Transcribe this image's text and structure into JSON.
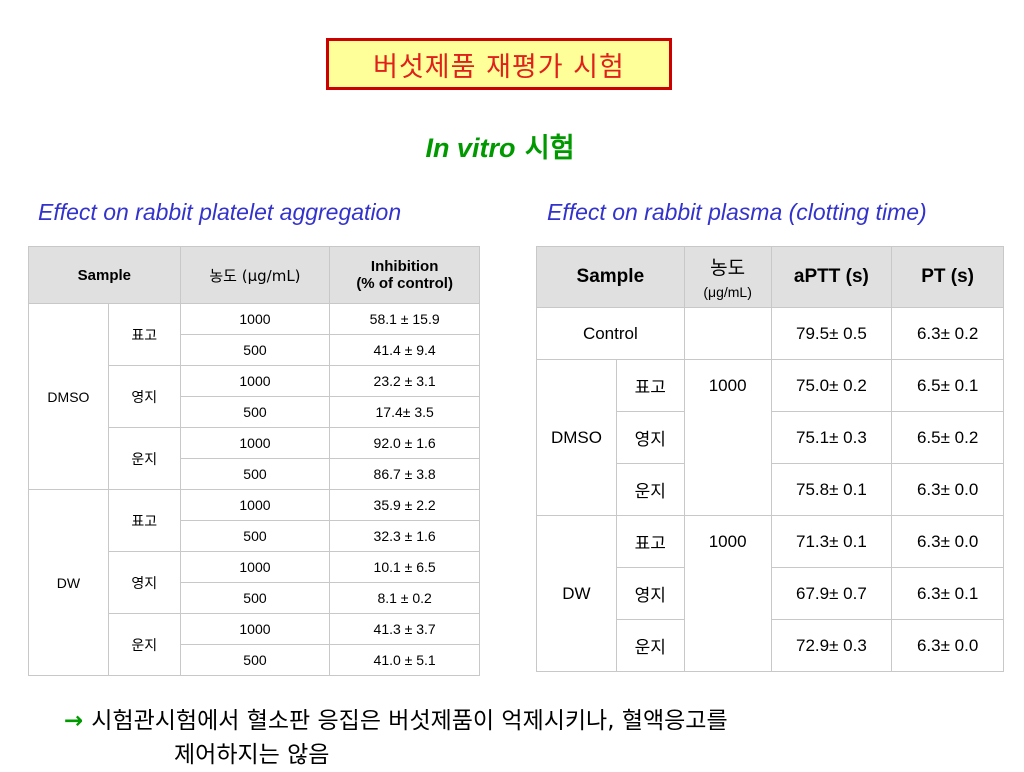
{
  "slide_title": "버섯제품 재평가 시험",
  "subtitle": {
    "italic": "In vitro",
    "rest": "시험"
  },
  "left_caption": "Effect on rabbit platelet aggregation",
  "right_caption": "Effect on rabbit plasma (clotting time)",
  "table1": {
    "headers": {
      "sample": "Sample",
      "conc": "농도 (μg/mL)",
      "inhibition_line1": "Inhibition",
      "inhibition_line2": "(% of control)"
    },
    "groups": [
      {
        "name": "DMSO",
        "subgroups": [
          {
            "name": "표고",
            "rows": [
              {
                "conc": "1000",
                "value": "58.1 ±  15.9"
              },
              {
                "conc": "500",
                "value": "41.4 ±  9.4"
              }
            ]
          },
          {
            "name": "영지",
            "rows": [
              {
                "conc": "1000",
                "value": "23.2 ±  3.1"
              },
              {
                "conc": "500",
                "value": "17.4±  3.5"
              }
            ]
          },
          {
            "name": "운지",
            "rows": [
              {
                "conc": "1000",
                "value": "92.0 ±  1.6"
              },
              {
                "conc": "500",
                "value": "86.7 ±  3.8"
              }
            ]
          }
        ]
      },
      {
        "name": "DW",
        "subgroups": [
          {
            "name": "표고",
            "rows": [
              {
                "conc": "1000",
                "value": "35.9 ±  2.2"
              },
              {
                "conc": "500",
                "value": "32.3 ±  1.6"
              }
            ]
          },
          {
            "name": "영지",
            "rows": [
              {
                "conc": "1000",
                "value": "10.1 ±  6.5"
              },
              {
                "conc": "500",
                "value": "8.1 ±  0.2"
              }
            ]
          },
          {
            "name": "운지",
            "rows": [
              {
                "conc": "1000",
                "value": "41.3 ±  3.7"
              },
              {
                "conc": "500",
                "value": "41.0 ±  5.1"
              }
            ]
          }
        ]
      }
    ]
  },
  "table2": {
    "headers": {
      "sample": "Sample",
      "conc_line1": "농도",
      "conc_line2": "(μg/mL)",
      "aptt": "aPTT (s)",
      "pt": "PT (s)"
    },
    "control": {
      "label": "Control",
      "conc": "",
      "aptt": "79.5±  0.5",
      "pt": "6.3±  0.2"
    },
    "groups": [
      {
        "name": "DMSO",
        "conc": "1000",
        "rows": [
          {
            "name": "표고",
            "aptt": "75.0±  0.2",
            "pt": "6.5±  0.1"
          },
          {
            "name": "영지",
            "aptt": "75.1±  0.3",
            "pt": "6.5±  0.2"
          },
          {
            "name": "운지",
            "aptt": "75.8±  0.1",
            "pt": "6.3±  0.0"
          }
        ]
      },
      {
        "name": "DW",
        "conc": "1000",
        "rows": [
          {
            "name": "표고",
            "aptt": "71.3±  0.1",
            "pt": "6.3±  0.0"
          },
          {
            "name": "영지",
            "aptt": "67.9±  0.7",
            "pt": "6.3±  0.1"
          },
          {
            "name": "운지",
            "aptt": "72.9±  0.3",
            "pt": "6.3±  0.0"
          }
        ]
      }
    ]
  },
  "conclusion": {
    "arrow": "→",
    "line1": "시험관시험에서 혈소판 응집은 버섯제품이 억제시키나, 혈액응고를",
    "line2": "제어하지는 않음"
  },
  "colors": {
    "title_text": "#e0201b",
    "title_border": "#cc0000",
    "title_bg": "#ffff99",
    "subtitle": "#009900",
    "caption": "#3333cc",
    "header_bg": "#e0e0e0"
  }
}
